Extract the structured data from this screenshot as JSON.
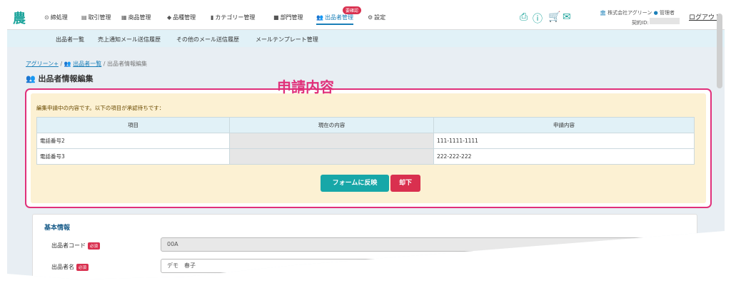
{
  "logo": "農",
  "nav": {
    "items": [
      {
        "icon": "⊙",
        "label": "締処理"
      },
      {
        "icon": "▤",
        "label": "取引管理"
      },
      {
        "icon": "▦",
        "label": "商品管理"
      },
      {
        "icon": "◆",
        "label": "品種管理"
      },
      {
        "icon": "▮",
        "label": "カテゴリー管理"
      },
      {
        "icon": "■",
        "label": "部門管理"
      },
      {
        "icon": "👥",
        "label": "出品者管理"
      },
      {
        "icon": "⚙",
        "label": "設定"
      }
    ],
    "badge": "要確認",
    "company": "株式会社アグリーン",
    "role": "管理者",
    "contract_label": "契約ID:",
    "logout": "ログアウト"
  },
  "subnav": {
    "items": [
      "出品者一覧",
      "売上通知メール送信履歴",
      "その他のメール送信履歴",
      "メールテンプレート管理"
    ]
  },
  "breadcrumb": {
    "home": "アグリーン+",
    "list": "出品者一覧",
    "current": "出品者情報編集"
  },
  "page_title": "出品者情報編集",
  "annotation": "申請内容",
  "pending": {
    "message": "編集申請中の内容です。以下の項目が承認待ちです：",
    "headers": {
      "item": "項目",
      "current": "現在の内容",
      "requested": "申請内容"
    },
    "rows": [
      {
        "item": "電話番号2",
        "current": "",
        "requested": "111-1111-1111"
      },
      {
        "item": "電話番号3",
        "current": "",
        "requested": "222-222-222"
      }
    ],
    "apply_button": "フォームに反映",
    "reject_button": "却下"
  },
  "basic_info": {
    "title": "基本情報",
    "required_badge": "必須",
    "fields": [
      {
        "label": "出品者コード",
        "value": "00A"
      },
      {
        "label": "出品者名",
        "value": "デモ　春子"
      }
    ]
  },
  "colors": {
    "brand": "#1aa39a",
    "active_nav": "#1a7fb8",
    "annotation": "#e0307a",
    "pending_bg": "#fcf1d3",
    "reject": "#d9304f"
  }
}
